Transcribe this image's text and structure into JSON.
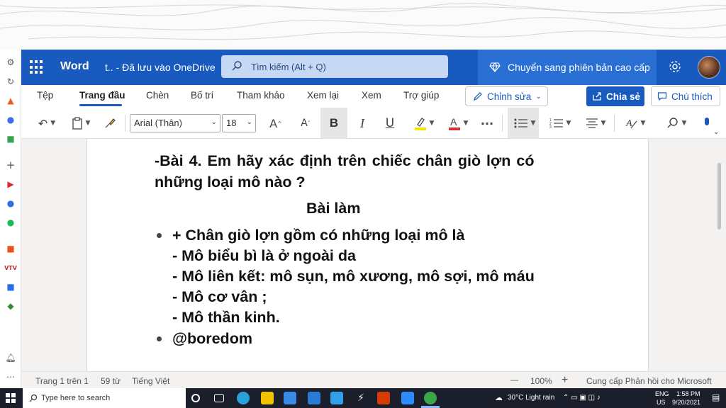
{
  "titlebar": {
    "app_name": "Word",
    "doc_title": "t.. -  Đã lưu vào OneDrive",
    "search_placeholder": "Tìm kiếm (Alt + Q)",
    "premium_label": "Chuyển sang phiên bản cao cấp",
    "brand_color": "#185abd"
  },
  "ribbon": {
    "tabs": [
      {
        "label": "Tệp"
      },
      {
        "label": "Trang đầu"
      },
      {
        "label": "Chèn"
      },
      {
        "label": "Bố trí"
      },
      {
        "label": "Tham khảo"
      },
      {
        "label": "Xem lại"
      },
      {
        "label": "Xem"
      },
      {
        "label": "Trợ giúp"
      }
    ],
    "active_tab": "Trang đầu",
    "edit_label": "Chỉnh sửa",
    "share_label": "Chia sẻ",
    "comment_label": "Chú thích"
  },
  "toolbar": {
    "font": "Arial (Thân)",
    "font_size": "18",
    "bold_label": "B",
    "italic_label": "I",
    "underline_label": "U",
    "highlight_color": "#f2e600",
    "font_color": "#d13438",
    "more_label": "···"
  },
  "document": {
    "lines": [
      "-Bài 4. Em hãy xác định trên chiếc chân giò lợn có",
      "những loại mô nào ?",
      "Bài làm",
      "+ Chân giò lợn gồm có những loại mô là",
      "- Mô biểu bì là ở ngoài da",
      "- Mô liên kết: mô sụn, mô xương, mô sợi, mô máu",
      "- Mô cơ vân ;",
      "- Mô thần kinh.",
      "@boredom"
    ]
  },
  "statusbar": {
    "page": "Trang 1 trên 1",
    "words": "59 từ",
    "language": "Tiếng Việt",
    "zoom_minus": "—",
    "zoom": "100%",
    "zoom_plus": "+",
    "feedback": "Cung cấp Phản hồi cho Microsoft"
  },
  "taskbar": {
    "search_placeholder": "Type here to search",
    "weather": "30°C  Light rain",
    "lang_top": "ENG",
    "lang_bottom": "US",
    "time": "1:58 PM",
    "date": "9/20/2021"
  },
  "sidebar_icons": [
    "gear-icon",
    "history-icon",
    "flame-icon",
    "messenger-icon",
    "game-icon",
    "add-icon",
    "youtube-icon",
    "facebook-icon",
    "spotify-icon",
    "office-icon",
    "vtv-icon",
    "news-icon",
    "graduation-icon",
    "bell-icon",
    "more-icon"
  ]
}
